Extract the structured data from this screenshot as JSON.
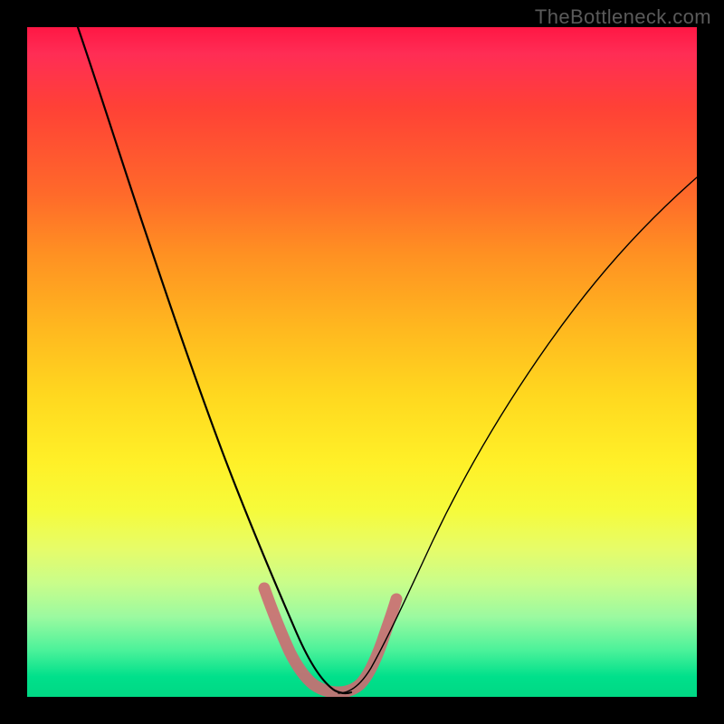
{
  "watermark": "TheBottleneck.com",
  "colors": {
    "page_bg": "#000000",
    "curve": "#000000",
    "valley_band": "#cc6b72",
    "gradient_top": "#ff1744",
    "gradient_bottom": "#00d884"
  },
  "chart_data": {
    "type": "line",
    "title": "",
    "xlabel": "",
    "ylabel": "",
    "xlim": [
      0,
      100
    ],
    "ylim": [
      0,
      100
    ],
    "grid": false,
    "legend": false,
    "background": {
      "description": "vertical rainbow gradient: red at top through orange, yellow, light green to green at bottom, indicating bottleneck severity (top=high, bottom=low)",
      "stops": [
        {
          "pos": 0,
          "color": "#ff1744"
        },
        {
          "pos": 12,
          "color": "#ff4136"
        },
        {
          "pos": 34,
          "color": "#ff9122"
        },
        {
          "pos": 55,
          "color": "#ffd81f"
        },
        {
          "pos": 72,
          "color": "#f6fb3a"
        },
        {
          "pos": 88,
          "color": "#9cfaa0"
        },
        {
          "pos": 100,
          "color": "#00d884"
        }
      ]
    },
    "x": [
      0,
      3,
      6,
      9,
      12,
      15,
      18,
      21,
      24,
      27,
      30,
      33,
      36,
      38,
      40,
      42,
      44,
      46,
      48,
      50,
      53,
      56,
      60,
      65,
      70,
      75,
      80,
      85,
      90,
      95,
      100
    ],
    "series": [
      {
        "name": "bottleneck-curve",
        "values": [
          100,
          91,
          83,
          75,
          67,
          60,
          53,
          46,
          39,
          33,
          27,
          21,
          15,
          10,
          6,
          3,
          1,
          0,
          0,
          2,
          6,
          11,
          17,
          24,
          31,
          38,
          45,
          51,
          57,
          63,
          68
        ]
      }
    ],
    "annotations": [
      {
        "type": "band",
        "name": "optimal-range",
        "color": "#cc6b72",
        "description": "thick pink/coral highlight tracing the curve around its minimum, indicating the optimal/ideal zone",
        "x_range": [
          35,
          52
        ],
        "follows_series": "bottleneck-curve"
      }
    ]
  }
}
